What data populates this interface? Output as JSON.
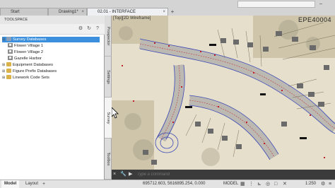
{
  "tabs": [
    {
      "label": "Start",
      "closable": false
    },
    {
      "label": "Drawing1*",
      "closable": true
    },
    {
      "label": "02.01 - INTERFACE",
      "closable": true,
      "active": true
    }
  ],
  "toolspace": {
    "title": "TOOLSPACE",
    "tree": [
      {
        "label": "Survey Databases",
        "level": 0,
        "toggle": "-",
        "icon": "database-icon",
        "selected": true
      },
      {
        "label": "Flower Village 1",
        "level": 1,
        "toggle": "",
        "icon": "survey-project-icon"
      },
      {
        "label": "Flower Village 2",
        "level": 1,
        "toggle": "",
        "icon": "survey-project-icon"
      },
      {
        "label": "Gazelle Harbor",
        "level": 1,
        "toggle": "",
        "icon": "survey-project-icon"
      },
      {
        "label": "Equipment Databases",
        "level": 0,
        "toggle": "+",
        "icon": "equipment-db-icon"
      },
      {
        "label": "Figure Prefix Databases",
        "level": 0,
        "toggle": "+",
        "icon": "figure-prefix-db-icon"
      },
      {
        "label": "Linework Code Sets",
        "level": 0,
        "toggle": "+",
        "icon": "linework-code-icon"
      }
    ],
    "vertical_tabs": [
      "Prospector",
      "Settings",
      "Survey",
      "Toolbox"
    ]
  },
  "map": {
    "corner_label": "EPE40004",
    "viewport_label": "[Top][2D Wireframe]"
  },
  "command_line": {
    "placeholder": "Type a command"
  },
  "status_bar": {
    "layout_tabs": [
      "Model",
      "Layout"
    ],
    "coordinates": "695712.603, 5616895.254, 0.000",
    "space": "MODEL",
    "scale": "1:250"
  },
  "colors": {
    "selection": "#3c8fdc",
    "command_line_bg": "#3b3b3b",
    "map_bg": "#e8e2cf"
  }
}
